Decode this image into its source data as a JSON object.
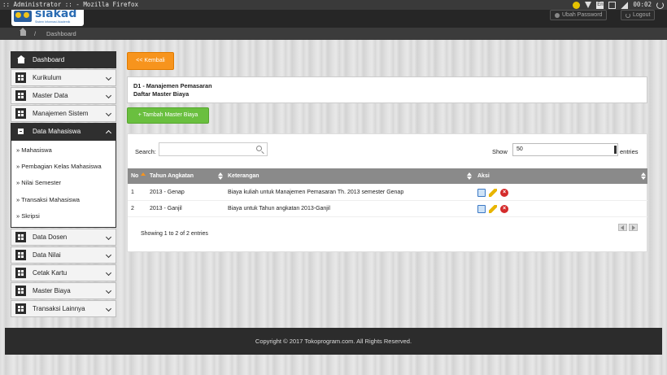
{
  "os": {
    "window_title": ":: Administrator :: - Mozilla Firefox",
    "lang": "En",
    "clock": "00:02"
  },
  "header": {
    "logo_name": "siakad",
    "logo_tagline": "Sistem Informasi Akademik",
    "ubah_password": "Ubah Password",
    "logout": "Logout"
  },
  "breadcrumb": {
    "separator": "/",
    "current": "Dashboard"
  },
  "sidebar": {
    "items": [
      {
        "label": "Dashboard"
      },
      {
        "label": "Kurikulum"
      },
      {
        "label": "Master Data"
      },
      {
        "label": "Manajemen Sistem"
      },
      {
        "label": "Data Mahasiswa"
      },
      {
        "label": "Data Dosen"
      },
      {
        "label": "Data Nilai"
      },
      {
        "label": "Cetak Kartu"
      },
      {
        "label": "Master Biaya"
      },
      {
        "label": "Transaksi Lainnya"
      }
    ],
    "submenu": [
      "» Mahasiswa",
      "» Pembagian Kelas Mahasiswa",
      "» Nilai Semester",
      "» Transaksi Mahasiswa",
      "» Skripsi"
    ]
  },
  "main": {
    "back_button": "<< Kembali",
    "info_line1": "D1 - Manajemen Pemasaran",
    "info_line2": "Daftar Master Biaya",
    "add_button": "+ Tambah Master Biaya"
  },
  "table": {
    "search_label": "Search:",
    "search_placeholder": "",
    "show_label": "Show",
    "page_length": "50",
    "entries_label": "entries",
    "columns": [
      "No",
      "Tahun Angkatan",
      "Keterangan",
      "Aksi"
    ],
    "rows": [
      {
        "no": "1",
        "tahun": "2013 - Genap",
        "keterangan": "Biaya kuliah untuk Manajemen Pemasaran Th. 2013 semester Genap"
      },
      {
        "no": "2",
        "tahun": "2013 - Ganjil",
        "keterangan": "Biaya untuk Tahun angkatan 2013-Ganjil"
      }
    ],
    "info": "Showing 1 to 2 of 2 entries"
  },
  "footer": {
    "copyright": "Copyright © 2017 Tokoprogram.com. All Rights Reserved."
  }
}
